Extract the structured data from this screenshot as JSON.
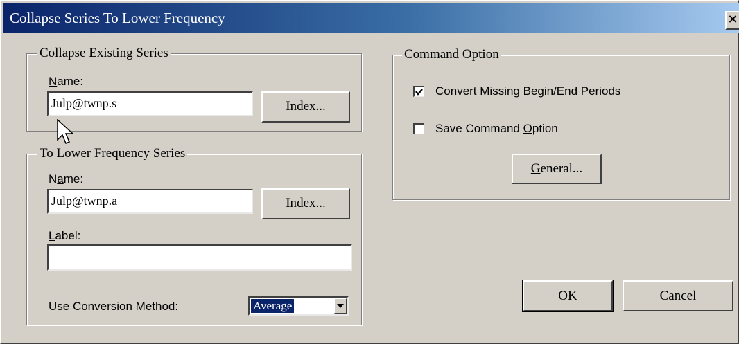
{
  "window": {
    "title": "Collapse Series To Lower Frequency",
    "close_glyph": "✕"
  },
  "collapse_existing": {
    "legend": "Collapse Existing Series",
    "name_label_first": "N",
    "name_label_rest": "ame:",
    "name_value": "Julp@twnp.s",
    "index_button_first": "I",
    "index_button_rest": "ndex..."
  },
  "lower_frequency": {
    "legend": "To Lower Frequency Series",
    "name_label_pre": "N",
    "name_label_ul": "a",
    "name_label_post": "me:",
    "name_value": "Julp@twnp.a",
    "index_button_pre": "In",
    "index_button_ul": "d",
    "index_button_post": "ex...",
    "label_label_ul": "L",
    "label_label_rest": "abel:",
    "label_value": "",
    "method_label_pre": "Use Conversion ",
    "method_label_ul": "M",
    "method_label_post": "ethod:",
    "method_value": "Average"
  },
  "command_option": {
    "legend": "Command Option",
    "convert_missing": {
      "checked": true,
      "label_ul": "C",
      "label_rest": "onvert Missing Begin/End Periods"
    },
    "save_option": {
      "checked": false,
      "label_pre": "Save Command ",
      "label_ul": "O",
      "label_post": "ption"
    },
    "general_button_ul": "G",
    "general_button_rest": "eneral..."
  },
  "buttons": {
    "ok": "OK",
    "cancel": "Cancel"
  },
  "icons": {
    "close": "close-icon",
    "check": "check-icon",
    "dropdown": "chevron-down-icon",
    "cursor": "mouse-pointer-icon"
  }
}
